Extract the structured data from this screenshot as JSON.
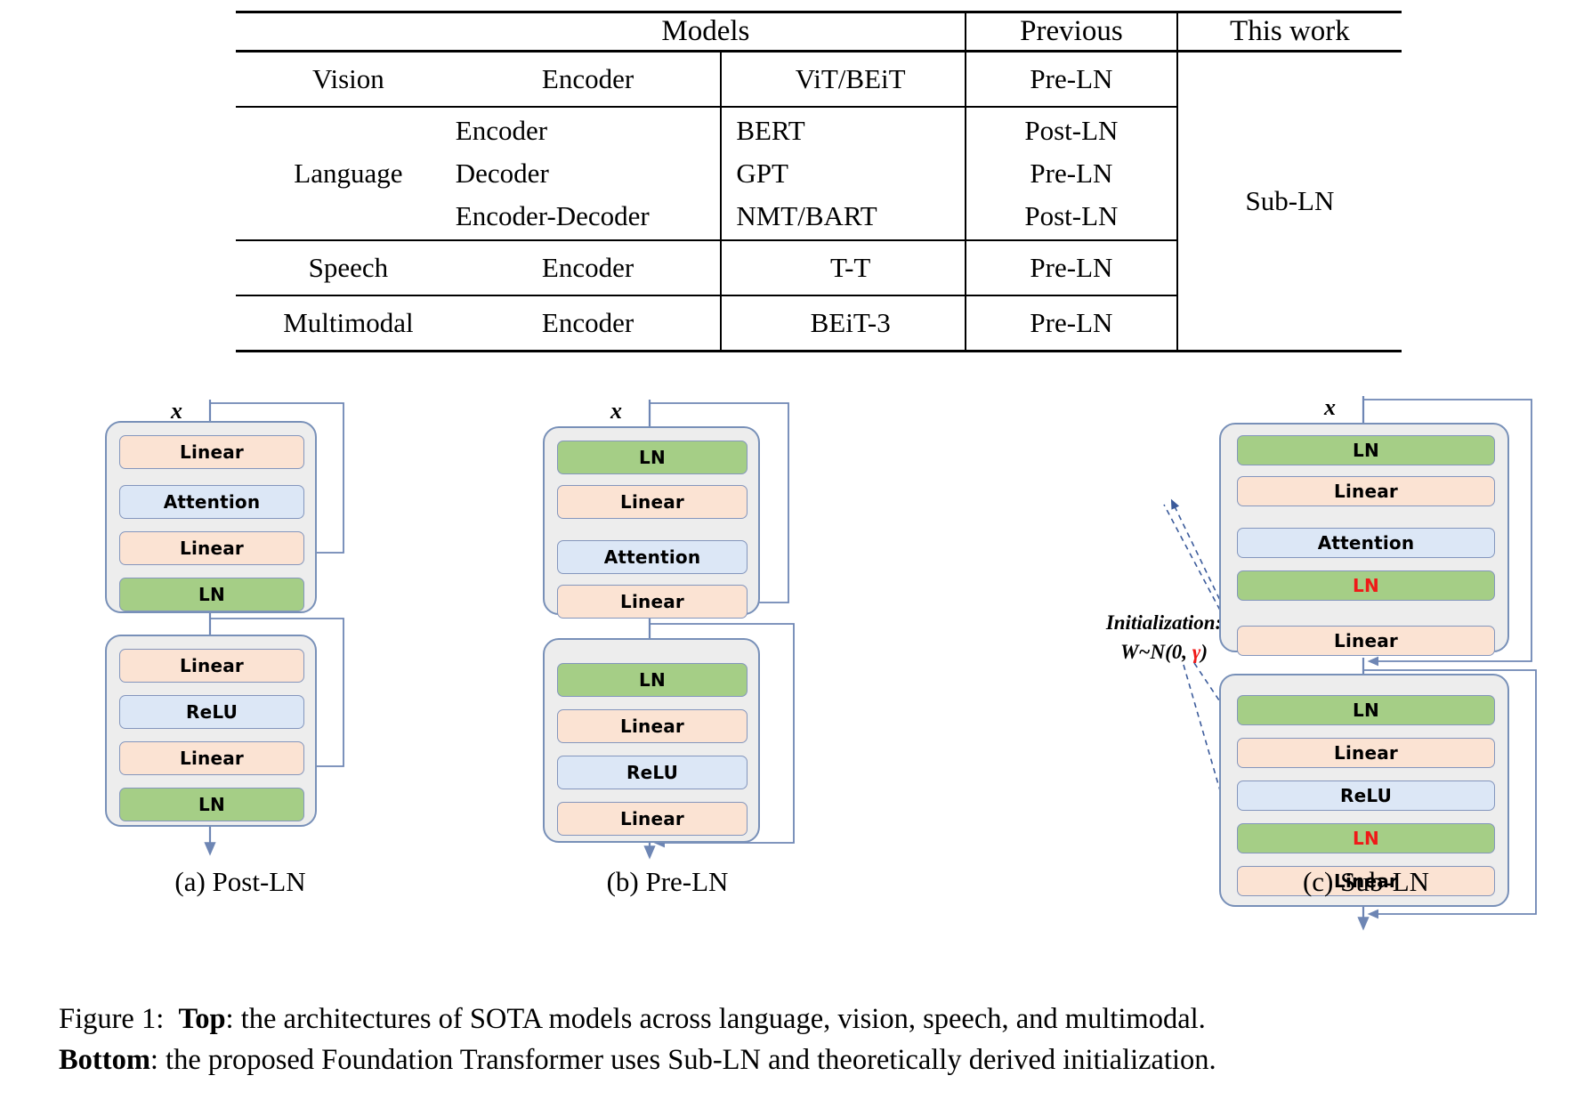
{
  "table": {
    "headers": {
      "category": "",
      "models": "Models",
      "previous": "Previous",
      "this_work": "This work"
    },
    "rows": [
      {
        "category": "Vision",
        "architectures": [
          "Encoder"
        ],
        "models": [
          "ViT/BEiT"
        ],
        "previous": [
          "Pre-LN"
        ],
        "this_work": ""
      },
      {
        "category": "Language",
        "architectures": [
          "Encoder",
          "Decoder",
          "Encoder-Decoder"
        ],
        "models": [
          "BERT",
          "GPT",
          "NMT/BART"
        ],
        "previous": [
          "Post-LN",
          "Pre-LN",
          "Post-LN"
        ],
        "this_work": "Sub-LN"
      },
      {
        "category": "Speech",
        "architectures": [
          "Encoder"
        ],
        "models": [
          "T-T"
        ],
        "previous": [
          "Pre-LN"
        ],
        "this_work": ""
      },
      {
        "category": "Multimodal",
        "architectures": [
          "Encoder"
        ],
        "models": [
          "BEiT-3"
        ],
        "previous": [
          "Pre-LN"
        ],
        "this_work": ""
      }
    ]
  },
  "figure": {
    "input_symbol": "x",
    "diagrams": [
      {
        "id": "post-ln",
        "caption": "(a)  Post-LN",
        "blocks": [
          {
            "name": "attention-block",
            "nodes": [
              {
                "label": "Linear",
                "type": "linear"
              },
              {
                "label": "Attention",
                "type": "attention"
              },
              {
                "label": "Linear",
                "type": "linear"
              },
              {
                "label": "LN",
                "type": "layernorm"
              }
            ]
          },
          {
            "name": "ffn-block",
            "nodes": [
              {
                "label": "Linear",
                "type": "linear"
              },
              {
                "label": "ReLU",
                "type": "activation"
              },
              {
                "label": "Linear",
                "type": "linear"
              },
              {
                "label": "LN",
                "type": "layernorm"
              }
            ]
          }
        ]
      },
      {
        "id": "pre-ln",
        "caption": "(b)  Pre-LN",
        "blocks": [
          {
            "name": "attention-block",
            "nodes": [
              {
                "label": "LN",
                "type": "layernorm"
              },
              {
                "label": "Linear",
                "type": "linear"
              },
              {
                "label": "Attention",
                "type": "attention"
              },
              {
                "label": "Linear",
                "type": "linear"
              }
            ]
          },
          {
            "name": "ffn-block",
            "nodes": [
              {
                "label": "LN",
                "type": "layernorm"
              },
              {
                "label": "Linear",
                "type": "linear"
              },
              {
                "label": "ReLU",
                "type": "activation"
              },
              {
                "label": "Linear",
                "type": "linear"
              }
            ]
          }
        ]
      },
      {
        "id": "sub-ln",
        "caption": "(c)  Sub-LN",
        "init_line1": "Initialization:",
        "init_line2_pre": "W~N(0, ",
        "init_line2_gamma": "γ",
        "init_line2_post": ")",
        "blocks": [
          {
            "name": "attention-block",
            "nodes": [
              {
                "label": "LN",
                "type": "layernorm"
              },
              {
                "label": "Linear",
                "type": "linear"
              },
              {
                "label": "Attention",
                "type": "attention"
              },
              {
                "label": "LN",
                "type": "layernorm-highlight"
              },
              {
                "label": "Linear",
                "type": "linear"
              }
            ]
          },
          {
            "name": "ffn-block",
            "nodes": [
              {
                "label": "LN",
                "type": "layernorm"
              },
              {
                "label": "Linear",
                "type": "linear"
              },
              {
                "label": "ReLU",
                "type": "activation"
              },
              {
                "label": "LN",
                "type": "layernorm-highlight"
              },
              {
                "label": "Linear",
                "type": "linear"
              }
            ]
          }
        ]
      }
    ]
  },
  "caption": {
    "figure_number": "Figure 1:",
    "top_label": "Top",
    "top_text": ": the architectures of SOTA models across language, vision, speech, and multimodal.",
    "bottom_label": "Bottom",
    "bottom_text": ": the proposed Foundation Transformer uses Sub-LN and theoretically derived initialization."
  },
  "colors": {
    "linear": "#FBE3D3",
    "attention": "#DCE7F6",
    "layernorm": "#A5CE86",
    "highlight_text": "#EF1A18",
    "block_bg": "#EDEDED",
    "border": "#7890B8",
    "arrow": "#6E86B4"
  }
}
